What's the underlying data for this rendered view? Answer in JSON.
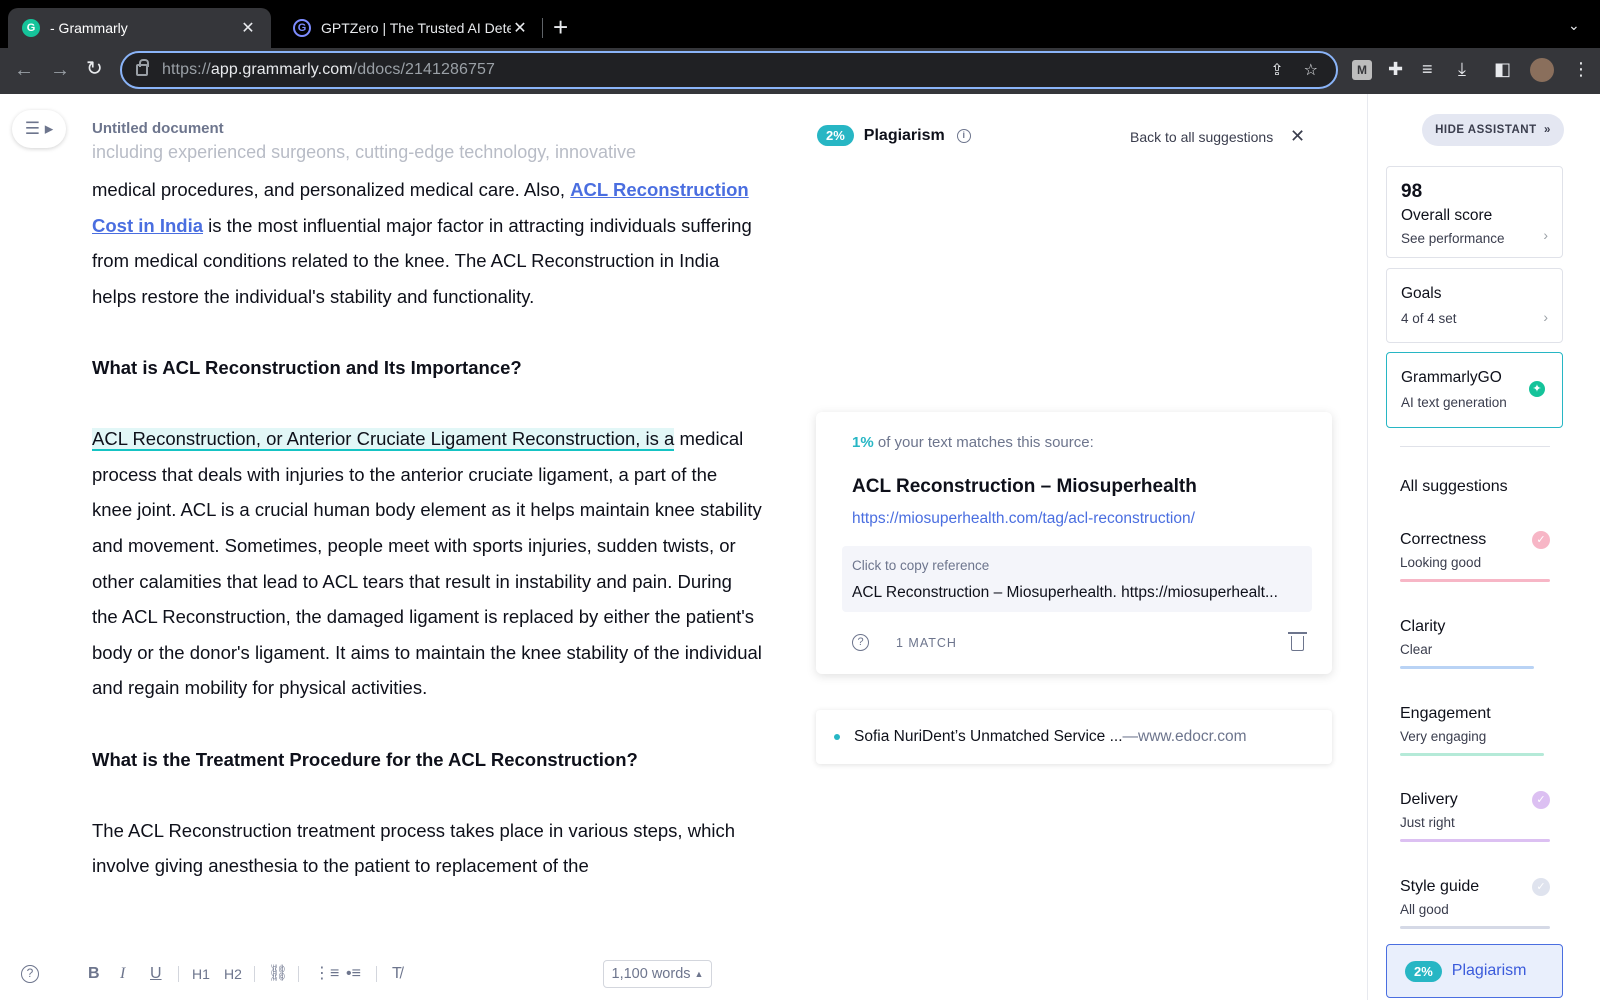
{
  "browser": {
    "tabs": [
      {
        "title": "- Grammarly",
        "favicon": "grammarly-g",
        "active": true
      },
      {
        "title": "GPTZero | The Trusted AI Dete",
        "favicon": "gptzero-logo",
        "active": false
      }
    ],
    "url_prefix": "https://",
    "url_host": "app.grammarly.com",
    "url_path": "/ddocs/2141286757"
  },
  "editor": {
    "doc_title": "Untitled document",
    "faded_line": "including experienced surgeons, cutting-edge technology, innovative",
    "para1_before_link": "medical procedures, and personalized medical care. Also, ",
    "para1_link": "ACL Reconstruction Cost in India",
    "para1_after_link": " is the most influential major factor in attracting individuals suffering from medical conditions related to the knee. The ACL Reconstruction in India helps restore the individual's stability and functionality.",
    "heading1": "What is ACL Reconstruction and Its Importance?",
    "para2_highlight": "ACL Reconstruction, or Anterior Cruciate Ligament Reconstruction, is a",
    "para2_rest": " medical process that deals with injuries to the anterior cruciate ligament, a part of the knee joint. ACL is a crucial human body element as it helps maintain knee stability and movement. Sometimes, people meet with sports injuries, sudden twists, or other calamities that lead to ACL tears that result in instability and pain. During the ACL Reconstruction, the damaged ligament is replaced by either the patient's body or the donor's ligament. It aims to maintain the knee stability of the individual and regain mobility for physical activities.",
    "heading2": "What is the Treatment Procedure for the ACL Reconstruction?",
    "para3": "The ACL Reconstruction treatment process takes place in various steps, which involve giving anesthesia to the patient to replacement of the",
    "toolbar": {
      "bold": "B",
      "italic": "I",
      "underline": "U",
      "h1": "H1",
      "h2": "H2"
    },
    "word_count": "1,100 words"
  },
  "plagiarism": {
    "percent": "2%",
    "title": "Plagiarism",
    "back_label": "Back to all suggestions",
    "match": {
      "percent": "1%",
      "lead_text": " of your text matches this source:",
      "source_title": "ACL Reconstruction – Miosuperhealth",
      "source_url": "https://miosuperhealth.com/tag/acl-reconstruction/",
      "copy_label": "Click to copy reference",
      "reference": "ACL Reconstruction – Miosuperhealth. https://miosuperhealt...",
      "count": "1 MATCH"
    },
    "other_source": {
      "title": "Sofia NuriDent’s Unmatched Service ...",
      "separator": " — ",
      "domain": "www.edocr.com"
    }
  },
  "assistant": {
    "hide_label": "HIDE ASSISTANT",
    "score": "98",
    "score_label": "Overall score",
    "score_sub": "See performance",
    "goals_label": "Goals",
    "goals_sub": "4 of 4 set",
    "go_label": "GrammarlyGO",
    "go_sub": "AI text generation",
    "all_suggestions": "All suggestions",
    "categories": [
      {
        "name": "Correctness",
        "status": "Looking good",
        "color": "#f05a7e",
        "bar": "#f7b6c6"
      },
      {
        "name": "Clarity",
        "status": "Clear",
        "color": "#4a90e2",
        "bar": "#b9d3f5"
      },
      {
        "name": "Engagement",
        "status": "Very engaging",
        "color": "#15c39a",
        "bar": "#b5ead8"
      },
      {
        "name": "Delivery",
        "status": "Just right",
        "color": "#b26ee0",
        "bar": "#dcc0f2"
      },
      {
        "name": "Style guide",
        "status": "All good",
        "color": "#9aa4c6",
        "bar": "#d5d9e6"
      }
    ],
    "plagiarism_percent": "2%",
    "plagiarism_label": "Plagiarism"
  },
  "colors": {
    "accent_teal": "#27b6c4",
    "link_blue": "#4a6ee0",
    "grammarly_green": "#15c39a"
  }
}
